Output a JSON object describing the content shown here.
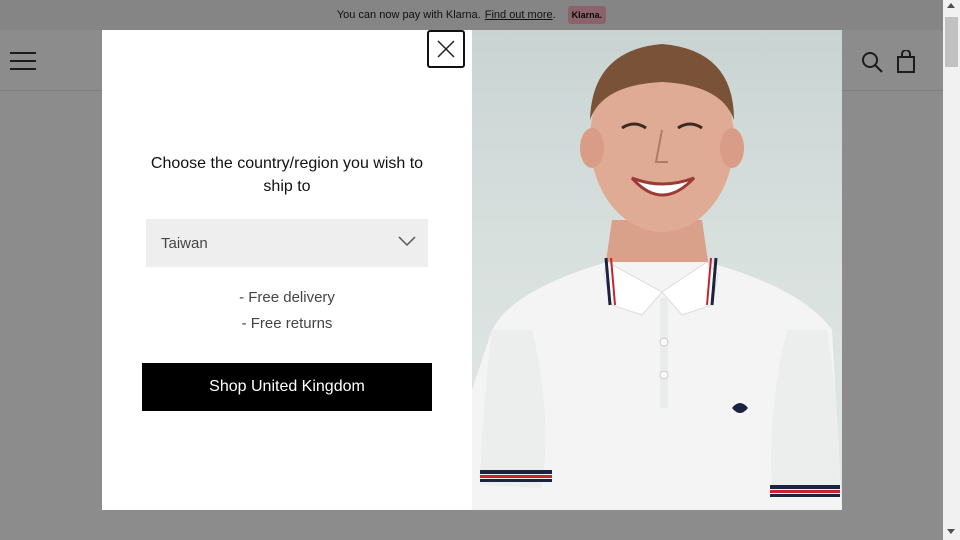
{
  "promo_bar": {
    "text": "You can now pay with Klarna.",
    "link_text": "Find out more",
    "trailing_dot": ".",
    "badge": "Klarna."
  },
  "header": {
    "icons": [
      "menu-icon",
      "search-icon",
      "shopping-bag-icon"
    ]
  },
  "modal": {
    "heading": "Choose the country/region you wish to ship to",
    "select": {
      "value": "Taiwan",
      "icon": "chevron-down-icon"
    },
    "benefits": [
      "- Free delivery",
      "- Free returns"
    ],
    "cta_label": "Shop United Kingdom",
    "close_icon": "close-icon"
  },
  "colors": {
    "cta_bg": "#000000",
    "klarna_badge": "#ffb3c7",
    "overlay": "rgba(0,0,0,0.45)"
  }
}
